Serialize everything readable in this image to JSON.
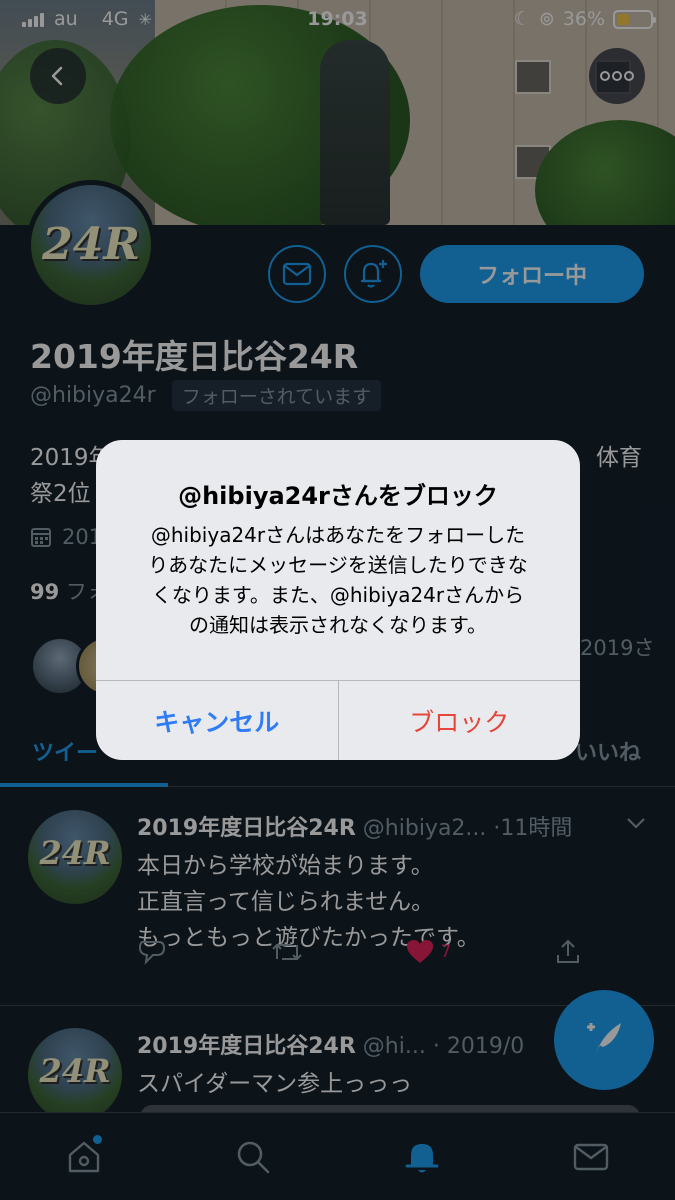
{
  "status": {
    "carrier": "au",
    "network": "4G",
    "time": "19:03",
    "battery": "36%",
    "battery_level": 0.36
  },
  "profile": {
    "name": "2019年度日比谷24R",
    "handle": "@hibiya24r",
    "follows_you": "フォローされています",
    "follow_button": "フォロー中",
    "avatar_text": "24R",
    "bio_start": "2019年",
    "bio_line2_start": "祭2位",
    "bio_right": "体育",
    "joined": "201",
    "follow_count": "99",
    "follow_label": "フォ",
    "mutual_right": "2019さ"
  },
  "tabs": {
    "tweets": "ツイー",
    "likes": "いいね"
  },
  "tweets": [
    {
      "name": "2019年度日比谷24R",
      "handle": "@hibiya2...",
      "time": "·11時間",
      "lines": [
        "本日から学校が始まります。",
        "正直言って信じられません。",
        "もっともっと遊びたかったです。"
      ],
      "likes": "7"
    },
    {
      "name": "2019年度日比谷24R",
      "handle": "@hi...",
      "time": "· 2019/0",
      "lines": [
        "スパイダーマン参上っっっ"
      ]
    }
  ],
  "dialog": {
    "title": "@hibiya24rさんをブロック",
    "message_lines": [
      "@hibiya24rさんはあなたをフォローした",
      "りあなたにメッセージを送信したりできな",
      "くなります。また、@hibiya24rさんから",
      "の通知は表示されなくなります。"
    ],
    "cancel": "キャンセル",
    "block": "ブロック"
  },
  "colors": {
    "accent": "#1da1f2",
    "background": "#15202b",
    "like": "#e0245e",
    "destructive": "#e5453a",
    "ios_blue": "#2f7cf6"
  },
  "icons": [
    "back-arrow-icon",
    "more-icon",
    "mail-icon",
    "bell-plus-icon",
    "calendar-icon",
    "reply-icon",
    "retweet-icon",
    "heart-icon",
    "share-icon",
    "compose-icon",
    "home-icon",
    "search-icon",
    "notifications-icon",
    "messages-icon"
  ]
}
